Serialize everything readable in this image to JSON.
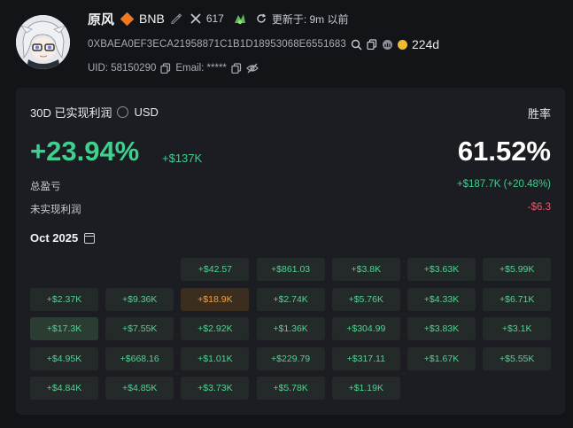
{
  "profile": {
    "name": "原风",
    "chain": "BNB",
    "x_followers": "617",
    "updated_label": "更新于: 9m 以前",
    "address": "0XBAEA0EF3ECA21958871C1B1D18953068E6551683",
    "age": "224d",
    "uid_text": "UID: 58150290",
    "email_text": "Email: *****"
  },
  "stats": {
    "period_title": "30D 已实现利润",
    "currency": "USD",
    "winrate_label": "胜率",
    "pnl_percent": "+23.94%",
    "pnl_usd": "+$137K",
    "winrate": "61.52%",
    "total_label": "总盈亏",
    "total_value": "+$187.7K (+20.48%)",
    "unrealized_label": "未实现利润",
    "unrealized_value": "-$6.3"
  },
  "calendar": {
    "month": "Oct 2025",
    "cells": [
      {
        "v": "+$42.57",
        "c": 2,
        "r": 0
      },
      {
        "v": "+$861.03",
        "c": 3,
        "r": 0
      },
      {
        "v": "+$3.8K",
        "c": 4,
        "r": 0
      },
      {
        "v": "+$3.63K",
        "c": 5,
        "r": 0
      },
      {
        "v": "+$5.99K",
        "c": 6,
        "r": 0
      },
      {
        "v": "+$2.37K",
        "c": 0,
        "r": 1
      },
      {
        "v": "+$9.36K",
        "c": 1,
        "r": 1
      },
      {
        "v": "+$18.9K",
        "c": 2,
        "r": 1,
        "style": "orange"
      },
      {
        "v": "+$2.74K",
        "c": 3,
        "r": 1
      },
      {
        "v": "+$5.76K",
        "c": 4,
        "r": 1
      },
      {
        "v": "+$4.33K",
        "c": 5,
        "r": 1
      },
      {
        "v": "+$6.71K",
        "c": 6,
        "r": 1
      },
      {
        "v": "+$17.3K",
        "c": 0,
        "r": 2,
        "style": "hi"
      },
      {
        "v": "+$7.55K",
        "c": 1,
        "r": 2
      },
      {
        "v": "+$2.92K",
        "c": 2,
        "r": 2
      },
      {
        "v": "+$1.36K",
        "c": 3,
        "r": 2
      },
      {
        "v": "+$304.99",
        "c": 4,
        "r": 2
      },
      {
        "v": "+$3.83K",
        "c": 5,
        "r": 2
      },
      {
        "v": "+$3.1K",
        "c": 6,
        "r": 2
      },
      {
        "v": "+$4.95K",
        "c": 0,
        "r": 3
      },
      {
        "v": "+$668.16",
        "c": 1,
        "r": 3
      },
      {
        "v": "+$1.01K",
        "c": 2,
        "r": 3
      },
      {
        "v": "+$229.79",
        "c": 3,
        "r": 3
      },
      {
        "v": "+$317.11",
        "c": 4,
        "r": 3
      },
      {
        "v": "+$1.67K",
        "c": 5,
        "r": 3
      },
      {
        "v": "+$5.55K",
        "c": 6,
        "r": 3
      },
      {
        "v": "+$4.84K",
        "c": 0,
        "r": 4
      },
      {
        "v": "+$4.85K",
        "c": 1,
        "r": 4
      },
      {
        "v": "+$3.73K",
        "c": 2,
        "r": 4
      },
      {
        "v": "+$5.78K",
        "c": 3,
        "r": 4
      },
      {
        "v": "+$1.19K",
        "c": 4,
        "r": 4
      }
    ]
  },
  "colors": {
    "profit": "#3fcf8e",
    "loss": "#f0566a",
    "highlight": "#f0a04b",
    "chain_badge": "#f0791d"
  }
}
